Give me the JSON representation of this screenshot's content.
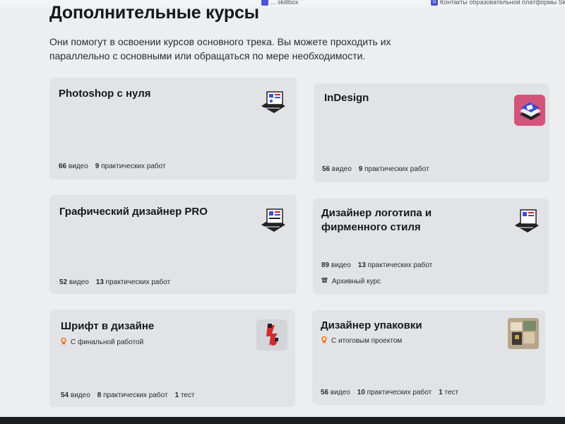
{
  "browser_tabs": [
    {
      "label": "... skillbox"
    },
    {
      "label": "Контакты образовательной платформы Skillbox",
      "favicon": "S"
    }
  ],
  "page": {
    "title": "Дополнительные курсы",
    "subtitle": "Они помогут в освоении курсов основного трека. Вы можете проходить их параллельно с основными или обращаться по мере необходимости."
  },
  "courses": [
    {
      "title": "Photoshop с нуля",
      "icon": "laptop-isometric-icon",
      "videos_num": "66",
      "videos_label": "видео",
      "works_num": "9",
      "works_label": "практических работ"
    },
    {
      "title": "InDesign",
      "icon": "indesign-books-icon",
      "videos_num": "56",
      "videos_label": "видео",
      "works_num": "9",
      "works_label": "практических работ"
    },
    {
      "title": "Графический дизайнер PRO",
      "icon": "laptop-isometric-icon",
      "videos_num": "52",
      "videos_label": "видео",
      "works_num": "13",
      "works_label": "практических работ"
    },
    {
      "title": "Дизайнер логотипа и фирменного стиля",
      "icon": "laptop-isometric-icon",
      "videos_num": "89",
      "videos_label": "видео",
      "works_num": "13",
      "works_label": "практических работ",
      "archive_label": "Архивный курс"
    },
    {
      "title": "Шрифт в дизайне",
      "icon": "red-letters-icon",
      "tag": "С финальной работой",
      "videos_num": "54",
      "videos_label": "видео",
      "works_num": "8",
      "works_label": "практических работ",
      "tests_num": "1",
      "tests_label": "тест"
    },
    {
      "title": "Дизайнер упаковки",
      "icon": "packaging-photo-icon",
      "tag": "С итоговым проектом",
      "videos_num": "56",
      "videos_label": "видео",
      "works_num": "10",
      "works_label": "практических работ",
      "tests_num": "1",
      "tests_label": "тест"
    }
  ],
  "colors": {
    "accent": "#ff6a00",
    "card_bg": "#e2e3e6",
    "page_bg": "#eceef0"
  }
}
